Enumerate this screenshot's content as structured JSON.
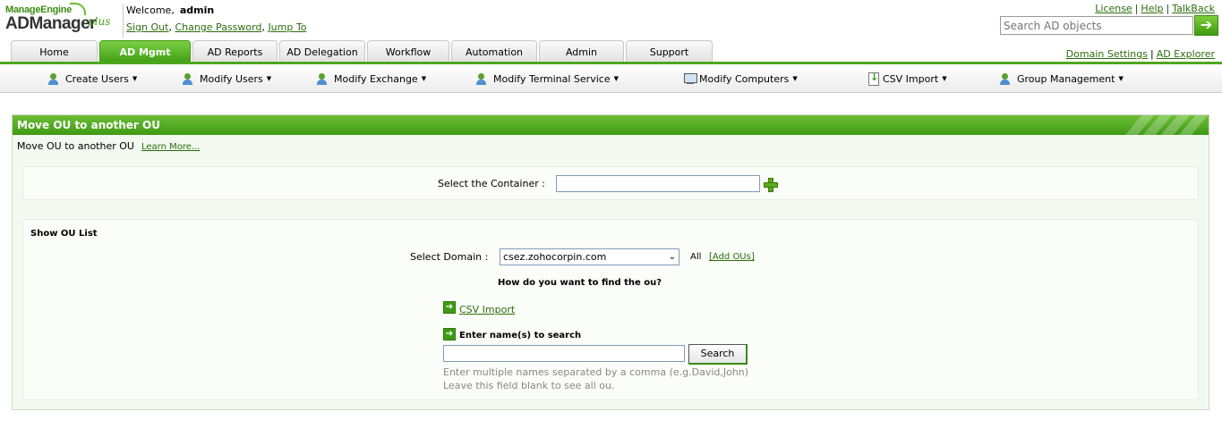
{
  "brand": {
    "company": "ManageEngine",
    "product": "ADManager",
    "edition": "plus"
  },
  "header": {
    "welcome": "Welcome,",
    "username": "admin",
    "sign_out": "Sign Out",
    "change_password": "Change Password",
    "jump_to": "Jump To",
    "license": "License",
    "help": "Help",
    "talkback": "TalkBack",
    "search_placeholder": "Search AD objects",
    "domain_settings": "Domain Settings",
    "ad_explorer": "AD Explorer"
  },
  "tabs": [
    {
      "label": "Home",
      "active": false
    },
    {
      "label": "AD Mgmt",
      "active": true
    },
    {
      "label": "AD Reports",
      "active": false
    },
    {
      "label": "AD Delegation",
      "active": false
    },
    {
      "label": "Workflow",
      "active": false
    },
    {
      "label": "Automation",
      "active": false
    },
    {
      "label": "Admin",
      "active": false
    },
    {
      "label": "Support",
      "active": false
    }
  ],
  "submenu": [
    {
      "label": "Create Users",
      "icon": "users-add-icon"
    },
    {
      "label": "Modify Users",
      "icon": "users-modify-icon"
    },
    {
      "label": "Modify Exchange",
      "icon": "exchange-icon"
    },
    {
      "label": "Modify Terminal Service",
      "icon": "terminal-service-icon"
    },
    {
      "label": "Modify Computers",
      "icon": "computer-icon"
    },
    {
      "label": "CSV Import",
      "icon": "csv-import-icon"
    },
    {
      "label": "Group Management",
      "icon": "group-icon"
    }
  ],
  "panel": {
    "title": "Move OU to another OU",
    "description": "Move OU to another OU",
    "learn_more": "Learn More...",
    "select_container_label": "Select the Container :",
    "select_container_value": "",
    "show_ou_list": "Show OU List",
    "select_domain_label": "Select Domain :",
    "select_domain_value": "csez.zohocorpin.com",
    "all": "All",
    "add_ous": "[Add OUs]",
    "how_find": "How do you want to find the ou?",
    "csv_import": "CSV Import",
    "enter_names": "Enter name(s) to search",
    "search_value": "",
    "search_button": "Search",
    "hint1": "Enter multiple names separated by a comma (e.g.David,John)",
    "hint2": "Leave this field blank to see all ou."
  },
  "colors": {
    "accent": "#4ea81c",
    "link": "#2a6e0a"
  }
}
